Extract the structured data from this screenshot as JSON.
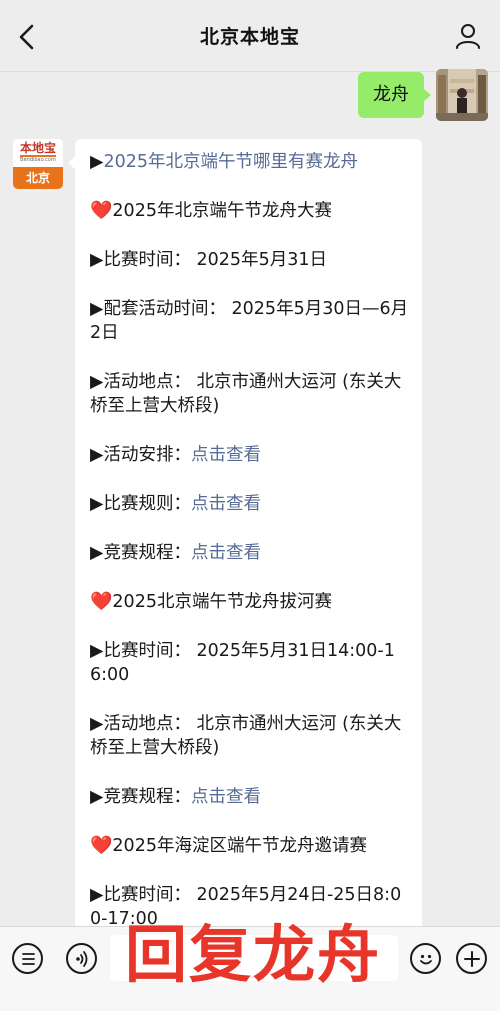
{
  "header": {
    "title": "北京本地宝",
    "back_icon": "back-chevron-icon",
    "profile_icon": "person-icon"
  },
  "user_message": {
    "text": "龙舟"
  },
  "bot": {
    "avatar_logo": "本地宝",
    "avatar_logo_sub": "Bendibao.com",
    "avatar_city": "北京",
    "paragraphs": [
      {
        "prefix": "▶",
        "link": "2025年北京端午节哪里有赛龙舟"
      },
      {
        "heart": "❤️",
        "text": "2025年北京端午节龙舟大赛"
      },
      {
        "prefix": "▶",
        "text": "比赛时间：  2025年5月31日"
      },
      {
        "prefix": "▶",
        "text": "配套活动时间：  2025年5月30日—6月2日"
      },
      {
        "prefix": "▶",
        "text": "活动地点：  北京市通州大运河 (东关大桥至上营大桥段)"
      },
      {
        "prefix": "▶",
        "text": "活动安排：",
        "link": "点击查看"
      },
      {
        "prefix": "▶",
        "text": "比赛规则：",
        "link": "点击查看"
      },
      {
        "prefix": "▶",
        "text": "竞赛规程：",
        "link": "点击查看"
      },
      {
        "heart": "❤️",
        "text": "2025北京端午节龙舟拔河赛"
      },
      {
        "prefix": "▶",
        "text": "比赛时间：  2025年5月31日14:00-16:00"
      },
      {
        "prefix": "▶",
        "text": "活动地点：  北京市通州大运河 (东关大桥至上营大桥段)"
      },
      {
        "prefix": "▶",
        "text": "竞赛规程：",
        "link": "点击查看"
      },
      {
        "heart": "❤️",
        "text": "2025年海淀区端午节龙舟邀请赛"
      },
      {
        "prefix": "▶",
        "text": "比赛时间：  2025年5月24日-25日8:00-17:00"
      }
    ]
  },
  "bottom_bar": {
    "menu_icon": "list-menu-icon",
    "voice_icon": "voice-icon",
    "emoji_icon": "emoji-icon",
    "plus_icon": "plus-icon",
    "overlay_text": "回复龙舟"
  },
  "colors": {
    "background": "#ededed",
    "user_bubble": "#95ec69",
    "link": "#576b95",
    "overlay": "#e8352a",
    "brand_orange": "#e8731a"
  }
}
